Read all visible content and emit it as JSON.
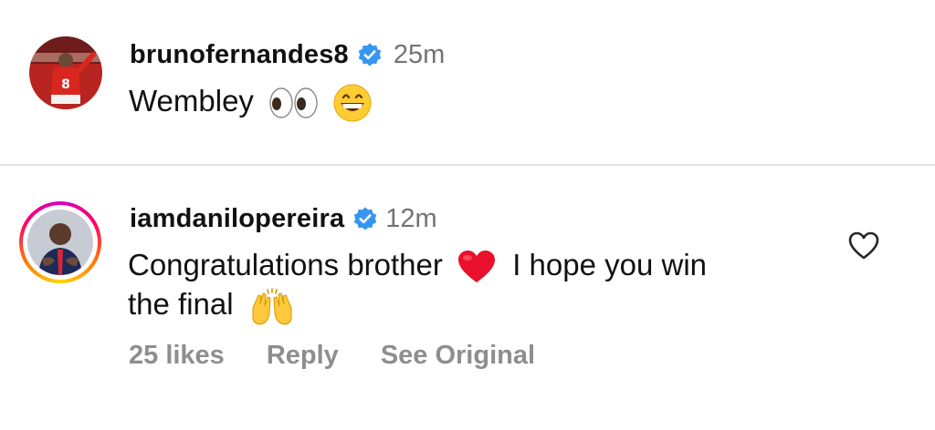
{
  "comments": [
    {
      "username": "brunofernandes8",
      "time": "25m",
      "text": "Wembley",
      "emojis": [
        "eyes-emoji",
        "grinning-face-emoji"
      ]
    },
    {
      "username": "iamdanilopereira",
      "time": "12m",
      "text_part1": "Congratulations brother",
      "text_part2": "I hope you win",
      "text_part3": "the final",
      "emojis": [
        "red-heart-emoji",
        "raising-hands-emoji"
      ],
      "likes": "25 likes",
      "reply_label": "Reply",
      "see_original_label": "See Original"
    }
  ],
  "colors": {
    "verified_blue": "#3797f0",
    "meta_gray": "#737373",
    "action_gray": "#8e8e8e",
    "divider": "#e3e3e3"
  }
}
